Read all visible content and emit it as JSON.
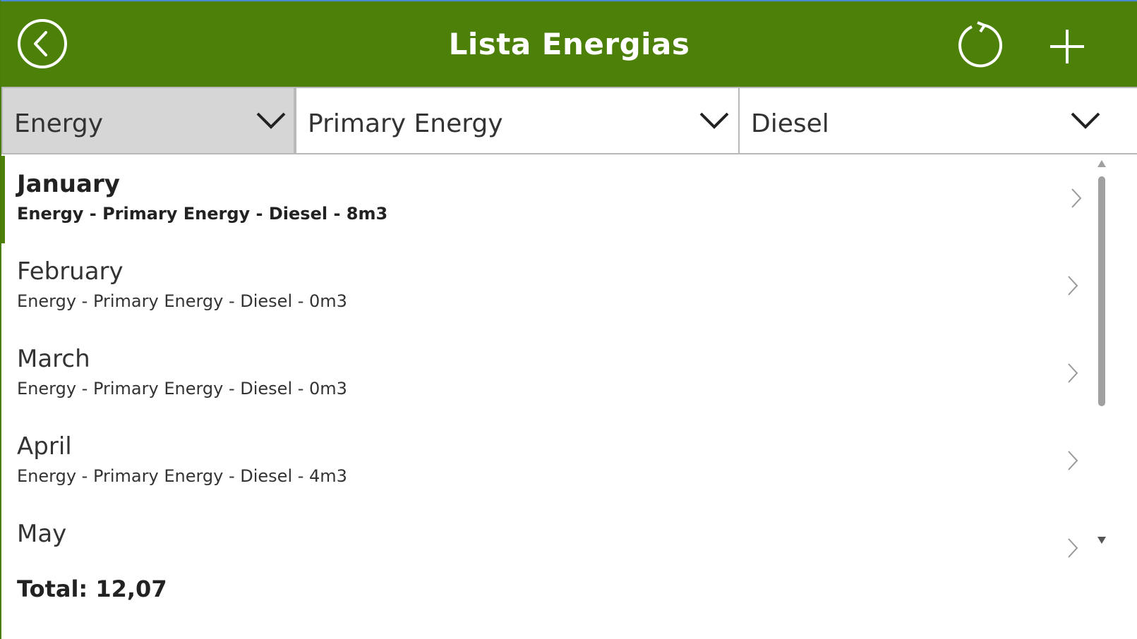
{
  "header": {
    "title": "Lista Energias",
    "back_icon": "back-arrow-circle-icon",
    "refresh_icon": "refresh-icon",
    "add_icon": "plus-icon",
    "background_color": "#4c8008"
  },
  "filters": {
    "category": {
      "value": "Energy"
    },
    "type": {
      "value": "Primary Energy"
    },
    "source": {
      "value": "Diesel"
    }
  },
  "list": {
    "items": [
      {
        "month": "January",
        "detail": "Energy - Primary Energy - Diesel - 8m3"
      },
      {
        "month": "February",
        "detail": "Energy - Primary Energy - Diesel - 0m3"
      },
      {
        "month": "March",
        "detail": "Energy - Primary Energy - Diesel - 0m3"
      },
      {
        "month": "April",
        "detail": "Energy - Primary Energy - Diesel - 4m3"
      },
      {
        "month": "May",
        "detail": ""
      }
    ]
  },
  "footer": {
    "total": "Total: 12,07"
  }
}
